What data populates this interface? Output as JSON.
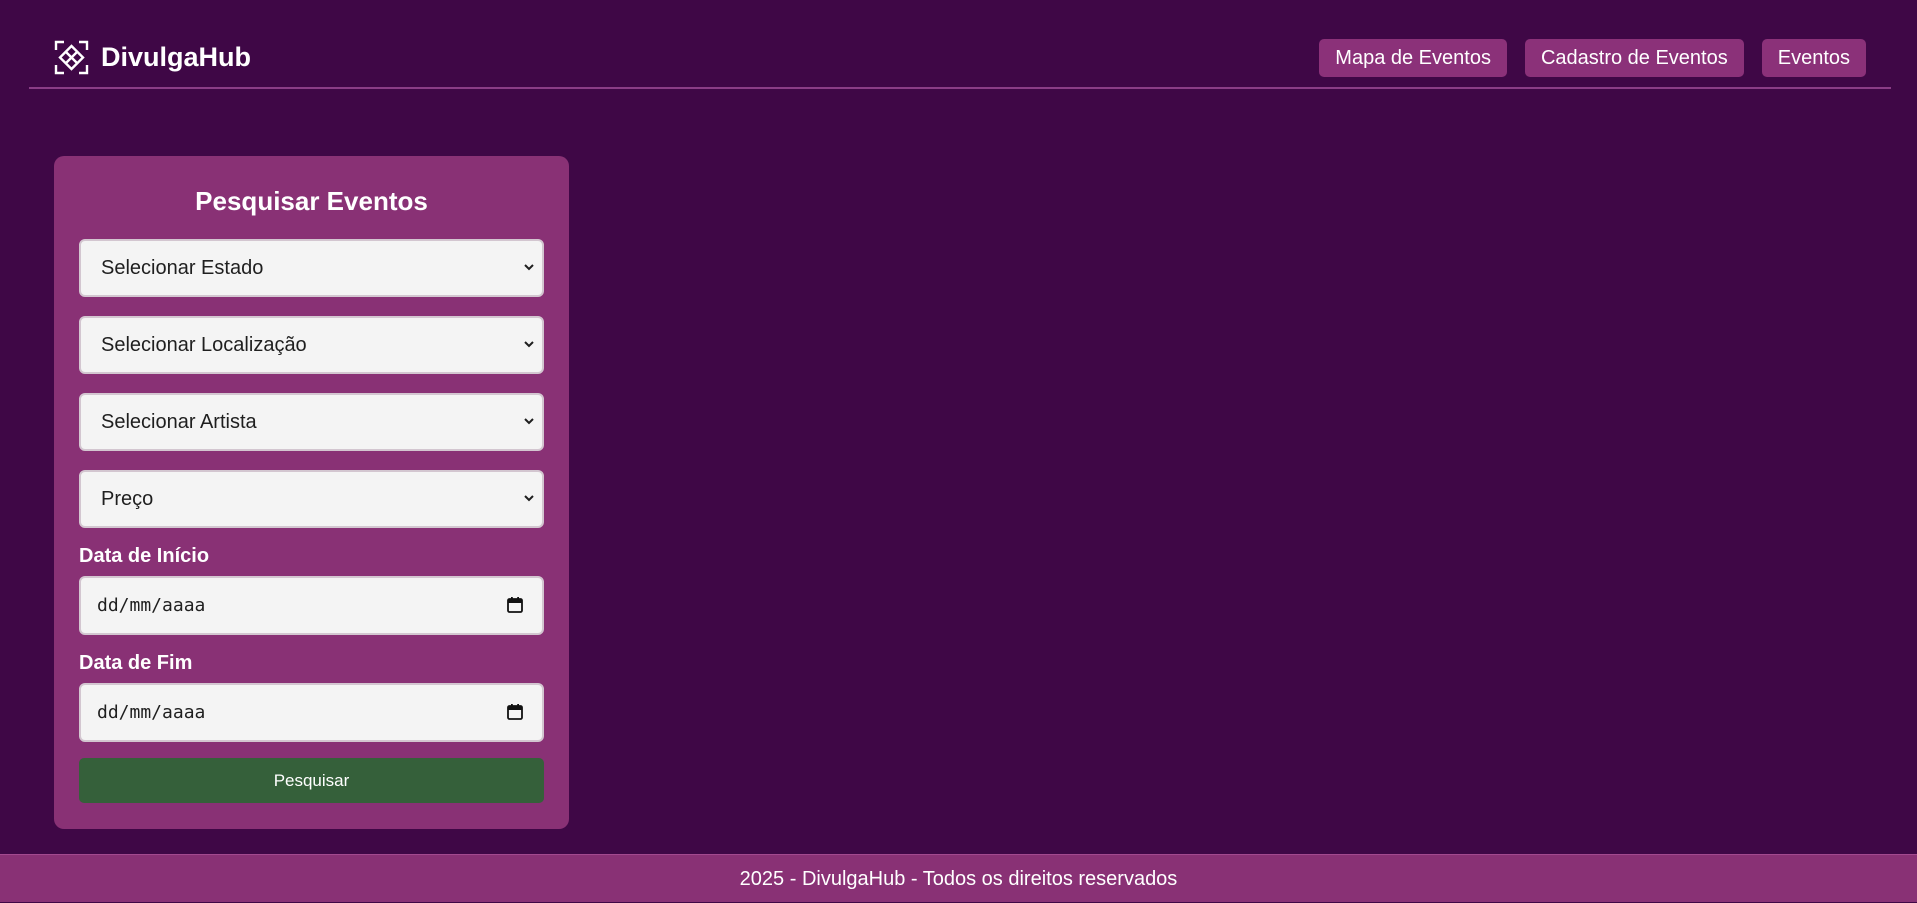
{
  "header": {
    "brand": "DivulgaHub",
    "logo_icon": "diamond-grid-icon",
    "nav": [
      {
        "label": "Mapa de Eventos"
      },
      {
        "label": "Cadastro de Eventos"
      },
      {
        "label": "Eventos"
      }
    ]
  },
  "search": {
    "title": "Pesquisar Eventos",
    "selects": [
      {
        "value": "Selecionar Estado"
      },
      {
        "value": "Selecionar Localização"
      },
      {
        "value": "Selecionar Artista"
      },
      {
        "value": "Preço"
      }
    ],
    "start_label": "Data de Início",
    "start_placeholder": "dd/mm/aaaa",
    "end_label": "Data de Fim",
    "end_placeholder": "dd/mm/aaaa",
    "submit_label": "Pesquisar"
  },
  "footer": {
    "text": "2025 - DivulgaHub - Todos os direitos reservados"
  },
  "colors": {
    "background": "#3f0746",
    "panel": "#893175",
    "nav_button": "#8b3179",
    "submit_button": "#35603a",
    "input_bg": "#f4f4f4"
  }
}
